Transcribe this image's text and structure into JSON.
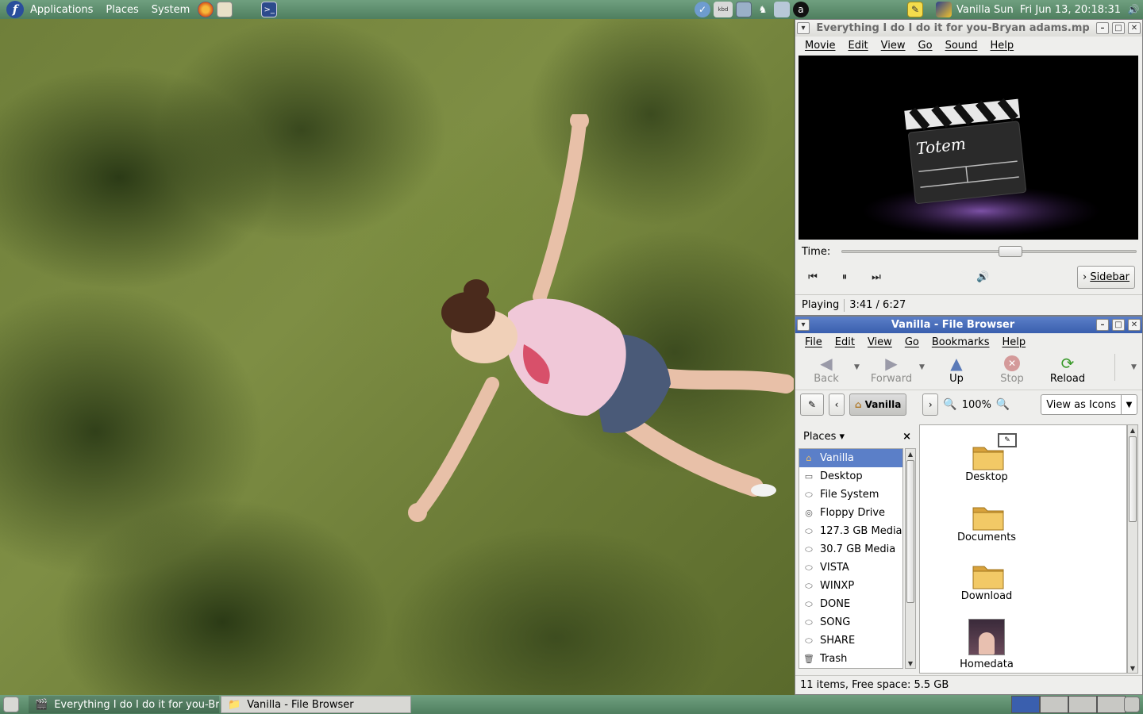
{
  "top_panel": {
    "menus": [
      "Applications",
      "Places",
      "System"
    ],
    "user": "Vanilla Sun",
    "clock": "Fri Jun 13, 20:18:31"
  },
  "totem": {
    "title": "Everything I do I do it for you-Bryan adams.mp",
    "menus": [
      "Movie",
      "Edit",
      "View",
      "Go",
      "Sound",
      "Help"
    ],
    "logo_text": "Totem",
    "time_label": "Time:",
    "progress": 0.58,
    "sidebar_button": "Sidebar",
    "status": "Playing",
    "elapsed": "3:41 / 6:27"
  },
  "browser": {
    "title": "Vanilla - File Browser",
    "menus": [
      "File",
      "Edit",
      "View",
      "Go",
      "Bookmarks",
      "Help"
    ],
    "toolbar": {
      "back": "Back",
      "forward": "Forward",
      "up": "Up",
      "stop": "Stop",
      "reload": "Reload"
    },
    "location": "Vanilla",
    "zoom": "100%",
    "view_mode": "View as Icons",
    "places_label": "Places",
    "places": [
      {
        "label": "Vanilla",
        "icon": "home-icon"
      },
      {
        "label": "Desktop",
        "icon": "desktop-icon"
      },
      {
        "label": "File System",
        "icon": "drive-icon"
      },
      {
        "label": "Floppy Drive",
        "icon": "floppy-icon"
      },
      {
        "label": "127.3 GB Media",
        "icon": "drive-icon"
      },
      {
        "label": "30.7 GB Media",
        "icon": "drive-icon"
      },
      {
        "label": "VISTA",
        "icon": "drive-icon"
      },
      {
        "label": "WINXP",
        "icon": "drive-icon"
      },
      {
        "label": "DONE",
        "icon": "drive-icon"
      },
      {
        "label": "SONG",
        "icon": "drive-icon"
      },
      {
        "label": "SHARE",
        "icon": "drive-icon"
      },
      {
        "label": "Trash",
        "icon": "trash-icon"
      }
    ],
    "files": [
      {
        "label": "Desktop",
        "icon": "folder-icon"
      },
      {
        "label": "Documents",
        "icon": "folder-icon"
      },
      {
        "label": "Download",
        "icon": "folder-icon"
      },
      {
        "label": "Homedata",
        "icon": "image-icon"
      }
    ],
    "status": "11 items, Free space: 5.5 GB"
  },
  "taskbar": {
    "tasks": [
      {
        "label": "Everything I do I do it for you-Bryan adams.mp",
        "active": false
      },
      {
        "label": "Vanilla - File Browser",
        "active": true
      }
    ]
  }
}
